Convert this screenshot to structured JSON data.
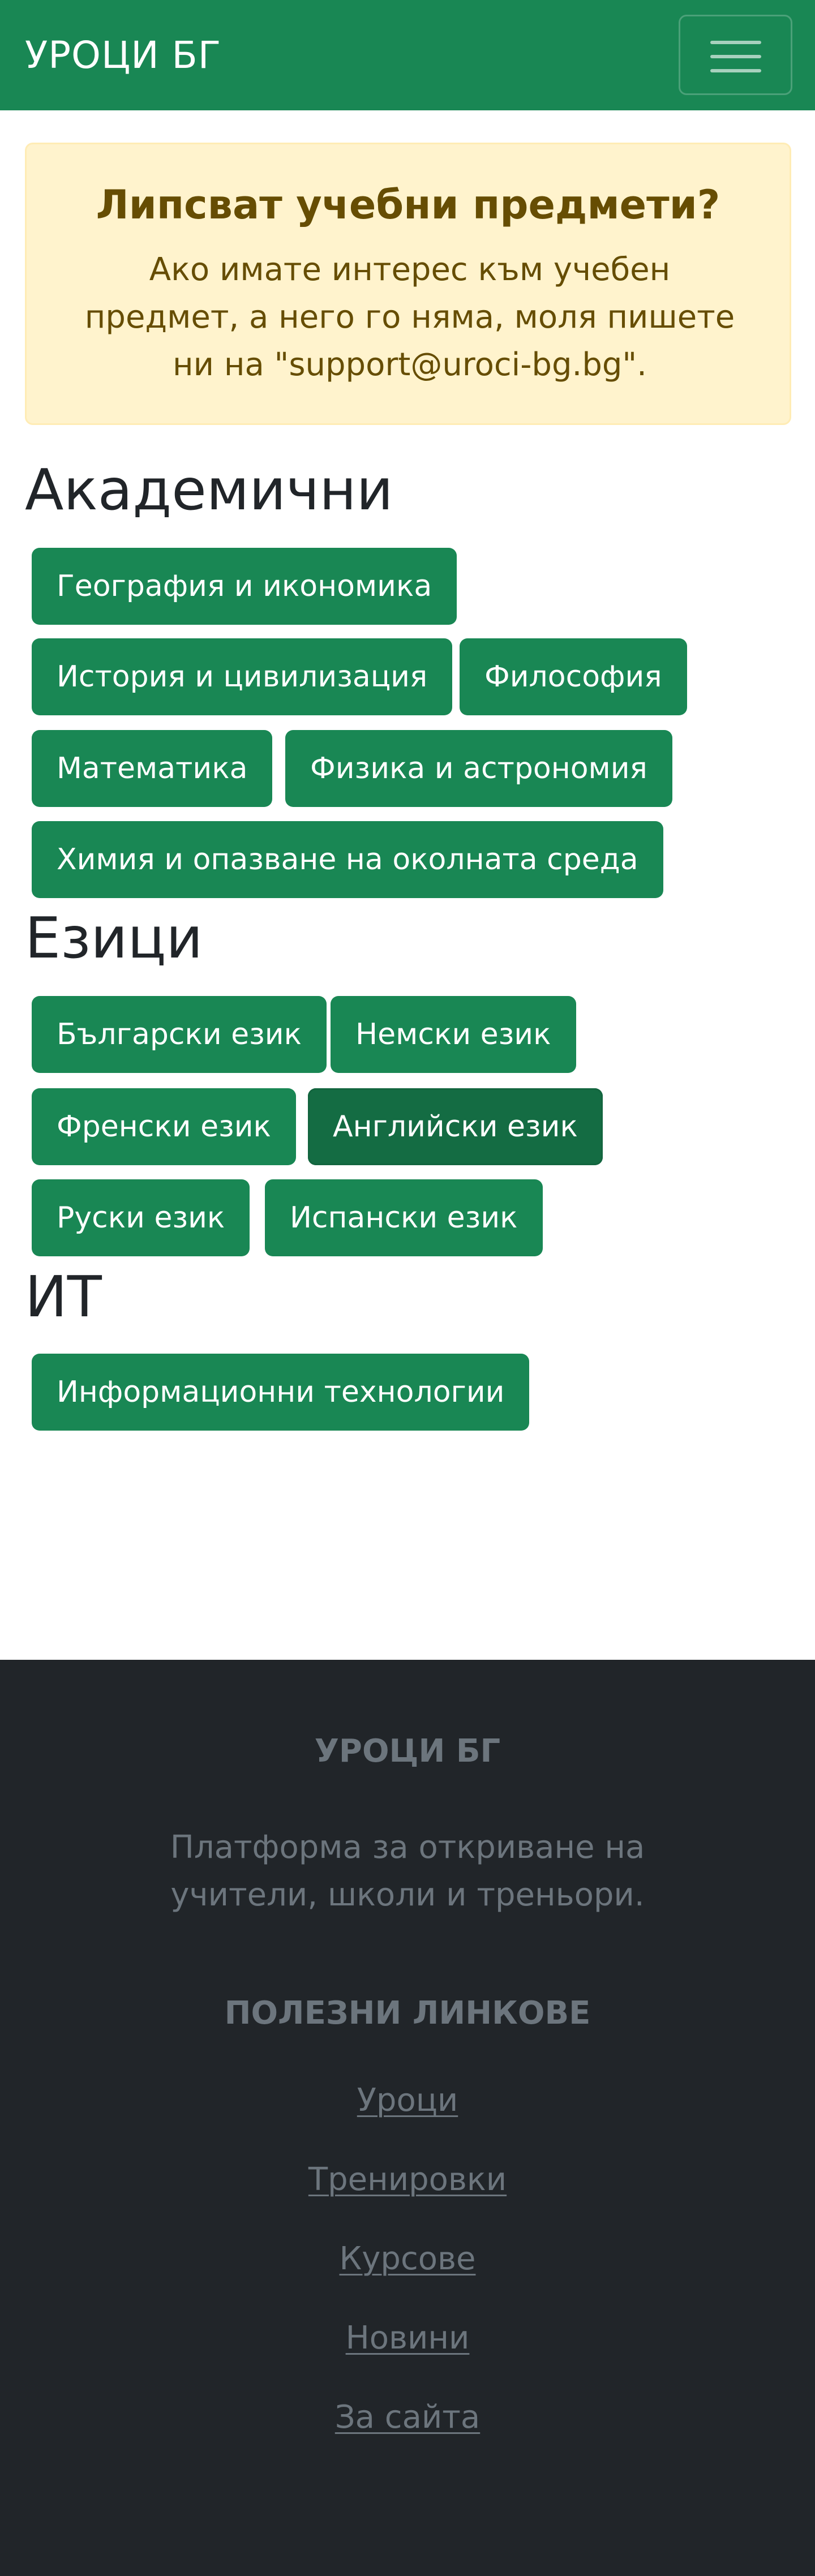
{
  "navbar": {
    "brand": "УРОЦИ БГ",
    "toggler_icon": "menu-hamburger-icon"
  },
  "notice": {
    "title": "Липсват учебни предмети?",
    "text": "Ако имате интерес към учебен предмет, а него го няма, моля пишете ни на \"support@uroci-bg.bg\"."
  },
  "sections": [
    {
      "title": "Академични",
      "subjects": [
        "География и икономика",
        "История и цивилизация",
        "Философия",
        "Математика",
        "Физика и астрономия",
        "Химия и опазване на околната среда"
      ]
    },
    {
      "title": "Езици",
      "subjects": [
        "Български език",
        "Немски език",
        "Френски език",
        "Английски език",
        "Руски език",
        "Испански език"
      ]
    },
    {
      "title": "ИТ",
      "subjects": [
        "Информационни технологии"
      ]
    }
  ],
  "footer": {
    "brand": "УРОЦИ БГ",
    "tagline": "Платформа за откриване на учители, школи и треньори.",
    "links_title": "ПОЛЕЗНИ ЛИНКОВЕ",
    "links": [
      "Уроци",
      "Тренировки",
      "Курсове",
      "Новини",
      "За сайта"
    ]
  },
  "colors": {
    "primary_green": "#198754",
    "active_green": "#146c43",
    "alert_background": "#fff3cd",
    "alert_text": "#664d03",
    "footer_background": "#212529",
    "footer_text": "#6c757d"
  }
}
